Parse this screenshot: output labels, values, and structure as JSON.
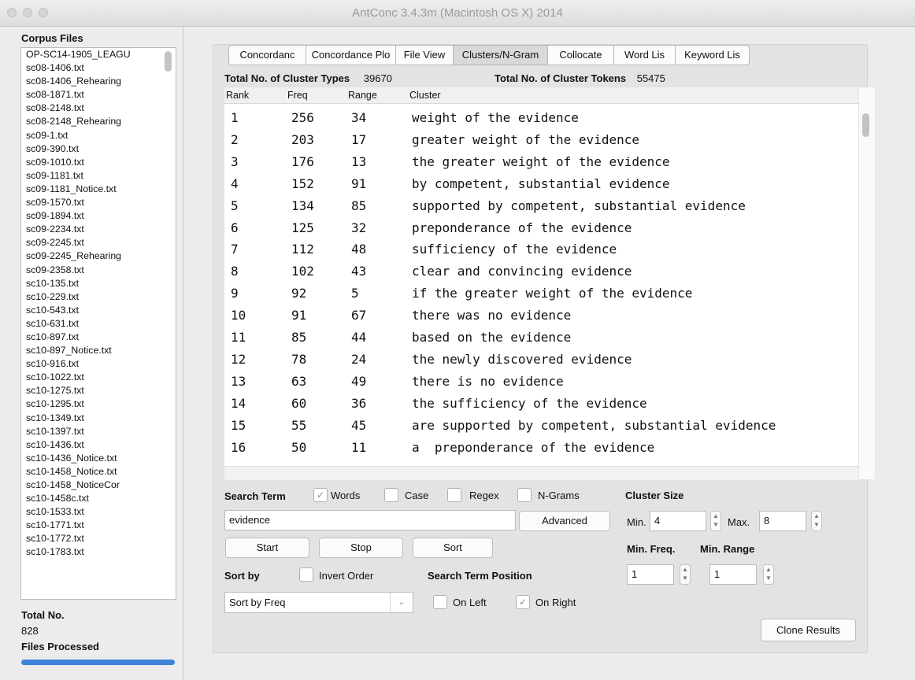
{
  "window": {
    "title": "AntConc 3.4.3m (Macintosh OS X) 2014"
  },
  "corpus": {
    "header": "Corpus Files",
    "files": [
      "OP-SC14-1905_LEAGU",
      "sc08-1406.txt",
      "sc08-1406_Rehearing",
      "sc08-1871.txt",
      "sc08-2148.txt",
      "sc08-2148_Rehearing",
      "sc09-1.txt",
      "sc09-390.txt",
      "sc09-1010.txt",
      "sc09-1181.txt",
      "sc09-1181_Notice.txt",
      "sc09-1570.txt",
      "sc09-1894.txt",
      "sc09-2234.txt",
      "sc09-2245.txt",
      "sc09-2245_Rehearing",
      "sc09-2358.txt",
      "sc10-135.txt",
      "sc10-229.txt",
      "sc10-543.txt",
      "sc10-631.txt",
      "sc10-897.txt",
      "sc10-897_Notice.txt",
      "sc10-916.txt",
      "sc10-1022.txt",
      "sc10-1275.txt",
      "sc10-1295.txt",
      "sc10-1349.txt",
      "sc10-1397.txt",
      "sc10-1436.txt",
      "sc10-1436_Notice.txt",
      "sc10-1458_Notice.txt",
      "sc10-1458_NoticeCor",
      "sc10-1458c.txt",
      "sc10-1533.txt",
      "sc10-1771.txt",
      "sc10-1772.txt",
      "sc10-1783.txt"
    ],
    "total_label": "Total No.",
    "total_value": "828",
    "processed_label": "Files Processed",
    "progress": 1.0
  },
  "tabs": [
    {
      "label": "Concordanc",
      "active": false
    },
    {
      "label": "Concordance Plo",
      "active": false
    },
    {
      "label": "File View",
      "active": false
    },
    {
      "label": "Clusters/N-Gram",
      "active": true
    },
    {
      "label": "Collocate",
      "active": false
    },
    {
      "label": "Word Lis",
      "active": false
    },
    {
      "label": "Keyword Lis",
      "active": false
    }
  ],
  "stats": {
    "types_label": "Total No. of Cluster Types",
    "types_value": "39670",
    "tokens_label": "Total No. of Cluster Tokens",
    "tokens_value": "55475"
  },
  "table": {
    "headers": [
      "Rank",
      "Freq",
      "Range",
      "Cluster"
    ],
    "rows": [
      [
        "1",
        "256",
        "34",
        "weight of the evidence"
      ],
      [
        "2",
        "203",
        "17",
        "greater weight of the evidence"
      ],
      [
        "3",
        "176",
        "13",
        "the greater weight of the evidence"
      ],
      [
        "4",
        "152",
        "91",
        "by competent, substantial evidence"
      ],
      [
        "5",
        "134",
        "85",
        "supported by competent, substantial evidence"
      ],
      [
        "6",
        "125",
        "32",
        "preponderance of the evidence"
      ],
      [
        "7",
        "112",
        "48",
        "sufficiency of the evidence"
      ],
      [
        "8",
        "102",
        "43",
        "clear and convincing evidence"
      ],
      [
        "9",
        "92",
        "5",
        "if the greater weight of the evidence"
      ],
      [
        "10",
        "91",
        "67",
        "there was no evidence"
      ],
      [
        "11",
        "85",
        "44",
        "based on the evidence"
      ],
      [
        "12",
        "78",
        "24",
        "the newly discovered evidence"
      ],
      [
        "13",
        "63",
        "49",
        "there is no evidence"
      ],
      [
        "14",
        "60",
        "36",
        "the sufficiency of the evidence"
      ],
      [
        "15",
        "55",
        "45",
        "are supported by competent, substantial evidence"
      ],
      [
        "16",
        "50",
        "11",
        "a  preponderance of the evidence"
      ]
    ]
  },
  "search": {
    "label": "Search Term",
    "words_label": "Words",
    "words_checked": true,
    "case_label": "Case",
    "case_checked": false,
    "regex_label": "Regex",
    "regex_checked": false,
    "ngrams_label": "N-Grams",
    "ngrams_checked": false,
    "value": "evidence",
    "advanced_label": "Advanced",
    "start_label": "Start",
    "stop_label": "Stop",
    "sort_label": "Sort"
  },
  "cluster_size": {
    "label": "Cluster Size",
    "min_label": "Min.",
    "min_value": "4",
    "max_label": "Max.",
    "max_value": "8",
    "min_freq_label": "Min. Freq.",
    "min_freq_value": "1",
    "min_range_label": "Min. Range",
    "min_range_value": "1"
  },
  "sort": {
    "label": "Sort by",
    "invert_label": "Invert Order",
    "invert_checked": false,
    "selected": "Sort by Freq"
  },
  "position": {
    "label": "Search Term Position",
    "left_label": "On Left",
    "left_checked": false,
    "right_label": "On Right",
    "right_checked": true
  },
  "clone_label": "Clone Results"
}
